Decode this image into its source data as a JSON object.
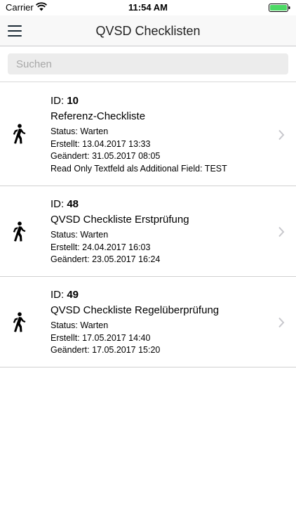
{
  "status_bar": {
    "carrier": "Carrier",
    "time": "11:54 AM",
    "battery_color": "#4cd964"
  },
  "header": {
    "title": "QVSD Checklisten",
    "menu_icon": "hamburger-menu-icon"
  },
  "search": {
    "placeholder": "Suchen",
    "value": ""
  },
  "checklists": [
    {
      "id_label": "ID:",
      "id": "10",
      "name": "Referenz-Checkliste",
      "status": "Status: Warten",
      "created": "Erstellt: 13.04.2017 13:33",
      "changed": "Geändert: 31.05.2017 08:05",
      "extra": "Read Only Textfeld als Additional Field: TEST",
      "icon": "walking-person-icon"
    },
    {
      "id_label": "ID:",
      "id": "48",
      "name": "QVSD Checkliste Erstprüfung",
      "status": "Status: Warten",
      "created": "Erstellt: 24.04.2017 16:03",
      "changed": "Geändert: 23.05.2017 16:24",
      "icon": "walking-person-icon"
    },
    {
      "id_label": "ID:",
      "id": "49",
      "name": "QVSD Checkliste Regelüberprüfung",
      "status": "Status: Warten",
      "created": "Erstellt: 17.05.2017 14:40",
      "changed": "Geändert: 17.05.2017 15:20",
      "icon": "walking-person-icon"
    }
  ]
}
